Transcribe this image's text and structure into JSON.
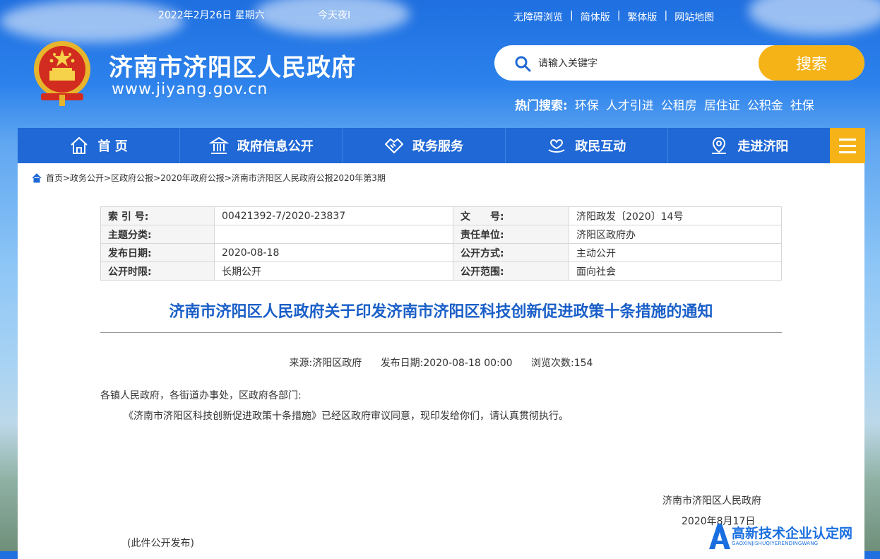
{
  "topbar": {
    "date": "2022年2月26日 星期六",
    "weather": "今天夜I",
    "links": [
      "无障碍浏览",
      "简体版",
      "繁体版",
      "网站地图"
    ]
  },
  "header": {
    "title": "济南市济阳区人民政府",
    "url": "www.jiyang.gov.cn"
  },
  "search": {
    "placeholder": "请输入关键字",
    "button": "搜索",
    "hot_label": "热门搜索:",
    "hot_terms": [
      "环保",
      "人才引进",
      "公租房",
      "居住证",
      "公积金",
      "社保"
    ]
  },
  "nav": {
    "items": [
      {
        "label": "首 页",
        "icon": "home-icon"
      },
      {
        "label": "政府信息公开",
        "icon": "building-icon"
      },
      {
        "label": "政务服务",
        "icon": "handshake-icon"
      },
      {
        "label": "政民互动",
        "icon": "heart-hand-icon"
      },
      {
        "label": "走进济阳",
        "icon": "map-pin-icon"
      }
    ]
  },
  "breadcrumb": "首页>政务公开>区政府公报>2020年政府公报>济南市济阳区人民政府公报2020年第3期",
  "meta": {
    "rows": [
      {
        "k1": "索 引 号:",
        "v1": "00421392-7/2020-23837",
        "k2": "文　　号:",
        "v2": "济阳政发〔2020〕14号"
      },
      {
        "k1": "主题分类:",
        "v1": "",
        "k2": "责任单位:",
        "v2": "济阳区政府办"
      },
      {
        "k1": "发布日期:",
        "v1": "2020-08-18",
        "k2": "公开方式:",
        "v2": "主动公开"
      },
      {
        "k1": "公开时限:",
        "v1": "长期公开",
        "k2": "公开范围:",
        "v2": "面向社会"
      }
    ]
  },
  "article": {
    "title": "济南市济阳区人民政府关于印发济南市济阳区科技创新促进政策十条措施的通知",
    "source": "来源:济阳区政府",
    "publish": "发布日期:2020-08-18 00:00",
    "views": "浏览次数:154",
    "salutation": "各镇人民政府，各街道办事处，区政府各部门:",
    "body": "《济南市济阳区科技创新促进政策十条措施》已经区政府审议同意，现印发给你们，请认真贯彻执行。",
    "signature": "济南市济阳区人民政府",
    "sign_date": "2020年8月17日",
    "note": "(此件公开发布)"
  },
  "watermark": {
    "title": "高新技术企业认定网",
    "sub": "GAOXINJISHUQIYERENDINGWANG"
  },
  "colors": {
    "nav_blue": "#1f68d6",
    "accent_yellow": "#f5b318",
    "title_blue": "#1a5fc8"
  }
}
